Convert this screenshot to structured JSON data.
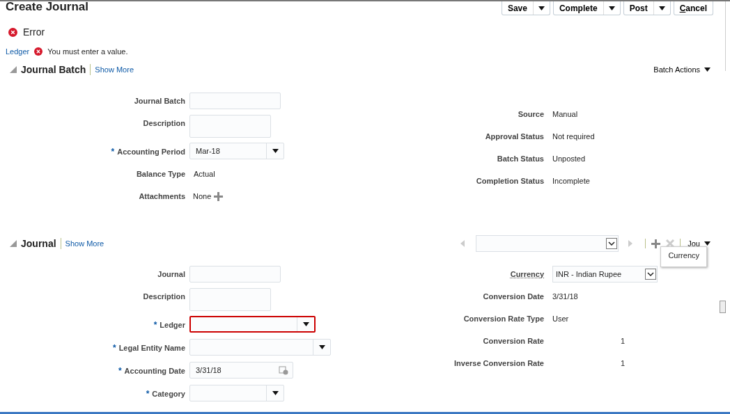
{
  "title": "Create Journal",
  "actions": [
    {
      "label": "Save",
      "menu": true
    },
    {
      "label": "Complete",
      "menu": true
    },
    {
      "label": "Post",
      "menu": true
    },
    {
      "label": "Cancel",
      "menu": false,
      "underline_first": true
    }
  ],
  "error": {
    "heading": "Error",
    "field": "Ledger",
    "message": "You must enter a value."
  },
  "batch": {
    "title": "Journal Batch",
    "show_more": "Show More",
    "actions": "Batch Actions",
    "expanded": true,
    "left": [
      {
        "kind": "text",
        "label": "Journal Batch"
      },
      {
        "kind": "textarea",
        "label": "Description"
      },
      {
        "kind": "select",
        "label": "Accounting Period",
        "mark": "*",
        "value": "Mar-18"
      },
      {
        "kind": "value",
        "label": "Balance Type",
        "value": "Actual"
      },
      {
        "kind": "attachments",
        "label": "Attachments",
        "value": "None"
      }
    ],
    "right": [
      {
        "kind": "value",
        "label": "Source",
        "value": "Manual"
      },
      {
        "kind": "value",
        "label": "Approval Status",
        "value": "Not required"
      },
      {
        "kind": "value",
        "label": "Batch Status",
        "value": "Unposted"
      },
      {
        "kind": "value",
        "label": "Completion Status",
        "value": "Incomplete"
      }
    ]
  },
  "journal": {
    "title": "Journal",
    "show_more": "Show More",
    "actions": "Jou",
    "expanded": true,
    "tooltip": "Currency",
    "left": [
      {
        "kind": "text",
        "label": "Journal"
      },
      {
        "kind": "textarea",
        "label": "Description"
      },
      {
        "kind": "select",
        "label": "Ledger",
        "mark": "*",
        "error": true
      },
      {
        "kind": "select",
        "label": "Legal Entity Name",
        "mark": "*",
        "wide": true
      },
      {
        "kind": "date",
        "label": "Accounting Date",
        "mark": "*",
        "value": "3/31/18"
      },
      {
        "kind": "select",
        "label": "Category",
        "mark": "*"
      }
    ],
    "right": [
      {
        "kind": "choice",
        "label": "Currency",
        "value": "INR - Indian Rupee"
      },
      {
        "kind": "value",
        "label": "Conversion Date",
        "value": "3/31/18"
      },
      {
        "kind": "value",
        "label": "Conversion Rate Type",
        "value": "User"
      },
      {
        "kind": "number",
        "label": "Conversion Rate",
        "value": "1"
      },
      {
        "kind": "number",
        "label": "Inverse Conversion Rate",
        "value": "1"
      }
    ]
  }
}
